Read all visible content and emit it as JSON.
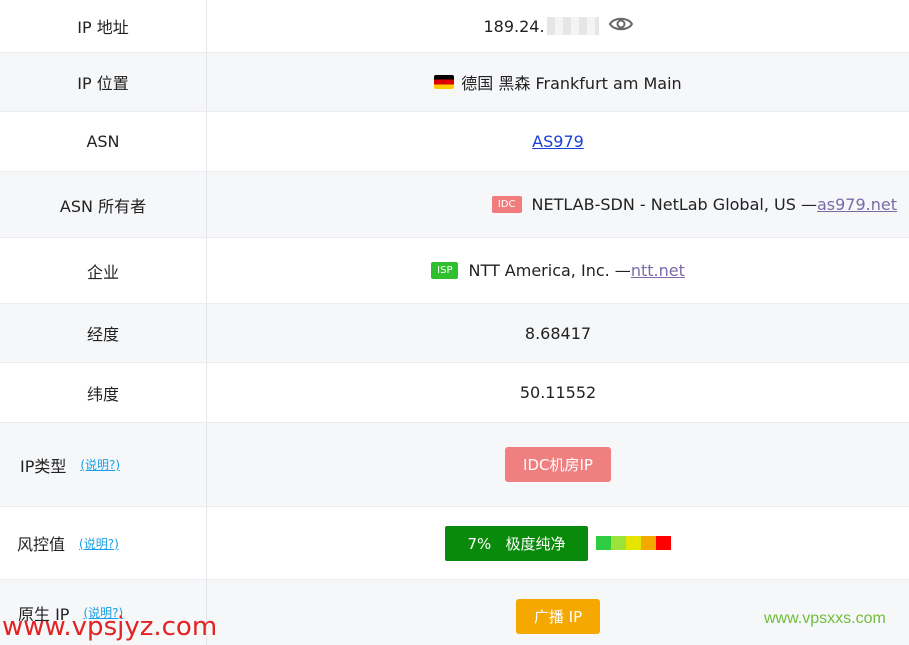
{
  "rows": [
    {
      "label": "IP 地址",
      "value_prefix": "189.24.",
      "icon": "eye-icon"
    },
    {
      "label": "IP 位置",
      "flag": "🇩🇪",
      "value": "德国 黑森 Frankfurt am Main"
    },
    {
      "label": "ASN",
      "link": "AS979"
    },
    {
      "label": "ASN 所有者",
      "tag": "IDC",
      "value": "NETLAB-SDN - NetLab Global, US —",
      "link": "as979.net"
    },
    {
      "label": "企业",
      "tag": "ISP",
      "value": "NTT America, Inc. —",
      "link": "ntt.net"
    },
    {
      "label": "经度",
      "value": "8.68417"
    },
    {
      "label": "纬度",
      "value": "50.11552"
    },
    {
      "label": "IP类型",
      "hint": "(说明?)",
      "badge": "IDC机房IP"
    },
    {
      "label": "风控值",
      "hint": "(说明?)",
      "badge": "7%   极度纯净",
      "risk_percent": 7
    },
    {
      "label": "原生 IP",
      "hint": "(说明?)",
      "badge": "广播 IP"
    }
  ],
  "colors": {
    "idc_tag": "#f07c7c",
    "isp_tag": "#2fbf2f",
    "risk_green": "#0a8a0a",
    "broadcast_orange": "#f5a800",
    "meter": [
      "#2ecc40",
      "#9be23a",
      "#e5e500",
      "#f5a800",
      "#ff0000"
    ]
  },
  "watermarks": {
    "left": "www.vpsjyz.com",
    "right": "www.vpsxxs.com"
  }
}
